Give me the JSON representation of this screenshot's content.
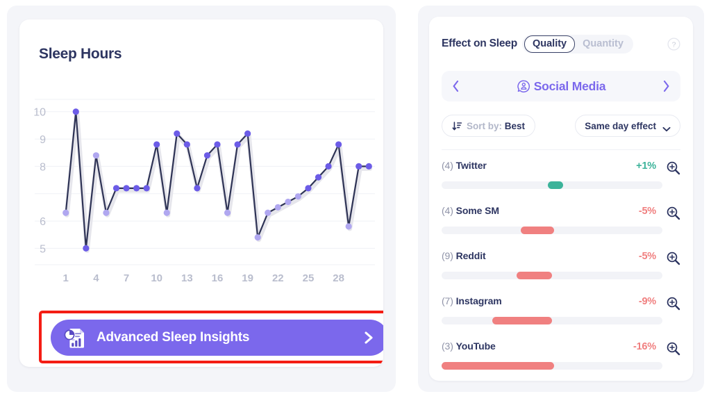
{
  "left_panel": {
    "card_title": "Sleep Hours",
    "insights_button": {
      "label": "Advanced Sleep Insights",
      "icon": "report-chart-icon",
      "chevron": "chevron-right-icon",
      "color": "#7b68ec",
      "highlight_color": "#f41d14"
    }
  },
  "chart_data": {
    "type": "line",
    "title": "Sleep Hours",
    "xlabel": "",
    "ylabel": "",
    "grid": true,
    "legend_position": "none",
    "x": [
      1,
      2,
      3,
      4,
      5,
      6,
      7,
      8,
      9,
      10,
      11,
      12,
      13,
      14,
      15,
      16,
      17,
      18,
      19,
      20,
      21,
      22,
      23,
      24,
      25,
      26,
      27,
      28,
      29,
      30,
      31
    ],
    "xticks": [
      "1",
      "4",
      "7",
      "10",
      "13",
      "16",
      "19",
      "22",
      "25",
      "28"
    ],
    "xtick_values": [
      1,
      4,
      7,
      10,
      13,
      16,
      19,
      22,
      25,
      28
    ],
    "yticks": [
      "10",
      "9",
      "8",
      "6",
      "5"
    ],
    "ytick_values": [
      10,
      9,
      8,
      6,
      5
    ],
    "ylim": [
      4.4,
      10.4
    ],
    "xlim": [
      0.4,
      31.6
    ],
    "values": [
      6.3,
      10.0,
      5.0,
      8.4,
      6.3,
      7.2,
      7.2,
      7.2,
      7.2,
      8.8,
      6.3,
      9.2,
      8.8,
      7.2,
      8.4,
      8.8,
      6.3,
      8.8,
      9.2,
      5.4,
      6.3,
      6.5,
      6.7,
      6.9,
      7.2,
      7.6,
      8.0,
      8.8,
      5.8,
      8.0,
      8.0
    ],
    "point_shades": [
      "light",
      "dark",
      "dark",
      "light",
      "light",
      "dark",
      "dark",
      "dark",
      "dark",
      "dark",
      "light",
      "dark",
      "dark",
      "dark",
      "dark",
      "dark",
      "light",
      "dark",
      "dark",
      "light",
      "light",
      "light",
      "light",
      "light",
      "dark",
      "dark",
      "dark",
      "dark",
      "light",
      "dark",
      "dark"
    ],
    "line_color": "#2e3355",
    "point_dark_color": "#6c5ce7",
    "point_light_color": "#b0a7f0",
    "band_color": "#e6e6ec",
    "grid_color": "#eff0f5",
    "tick_label_color": "#b9bdcd"
  },
  "right_panel": {
    "header": {
      "title": "Effect on Sleep",
      "segments": [
        {
          "label": "Quality",
          "active": true
        },
        {
          "label": "Quantity",
          "active": false
        }
      ],
      "help_icon": "question-circle-icon"
    },
    "category_nav": {
      "prev_icon": "chevron-left-icon",
      "next_icon": "chevron-right-icon",
      "category_icon": "social-media-icon",
      "category_name": "Social Media",
      "accent_color": "#7b68ec"
    },
    "controls": {
      "sort_icon": "sort-descending-icon",
      "sort_prefix": "Sort by: ",
      "sort_value": "Best",
      "select_value": "Same day effect",
      "select_icon": "chevron-down-icon"
    },
    "items": [
      {
        "count": "(4)",
        "name": "Twitter",
        "percent": "+1%",
        "positive": true,
        "bar_start": 48,
        "bar_end": 55,
        "zoom_icon": "zoom-in-icon"
      },
      {
        "count": "(4)",
        "name": "Some SM",
        "percent": "-5%",
        "positive": false,
        "bar_start": 36,
        "bar_end": 51,
        "zoom_icon": "zoom-in-icon"
      },
      {
        "count": "(9)",
        "name": "Reddit",
        "percent": "-5%",
        "positive": false,
        "bar_start": 34,
        "bar_end": 50,
        "zoom_icon": "zoom-in-icon"
      },
      {
        "count": "(7)",
        "name": "Instagram",
        "percent": "-9%",
        "positive": false,
        "bar_start": 23,
        "bar_end": 50,
        "zoom_icon": "zoom-in-icon"
      },
      {
        "count": "(3)",
        "name": "YouTube",
        "percent": "-16%",
        "positive": false,
        "bar_start": 0,
        "bar_end": 51,
        "zoom_icon": "zoom-in-icon"
      }
    ],
    "colors": {
      "positive": "#3cb39a",
      "negative": "#f08080",
      "bar_track": "#f2f3f7"
    }
  }
}
